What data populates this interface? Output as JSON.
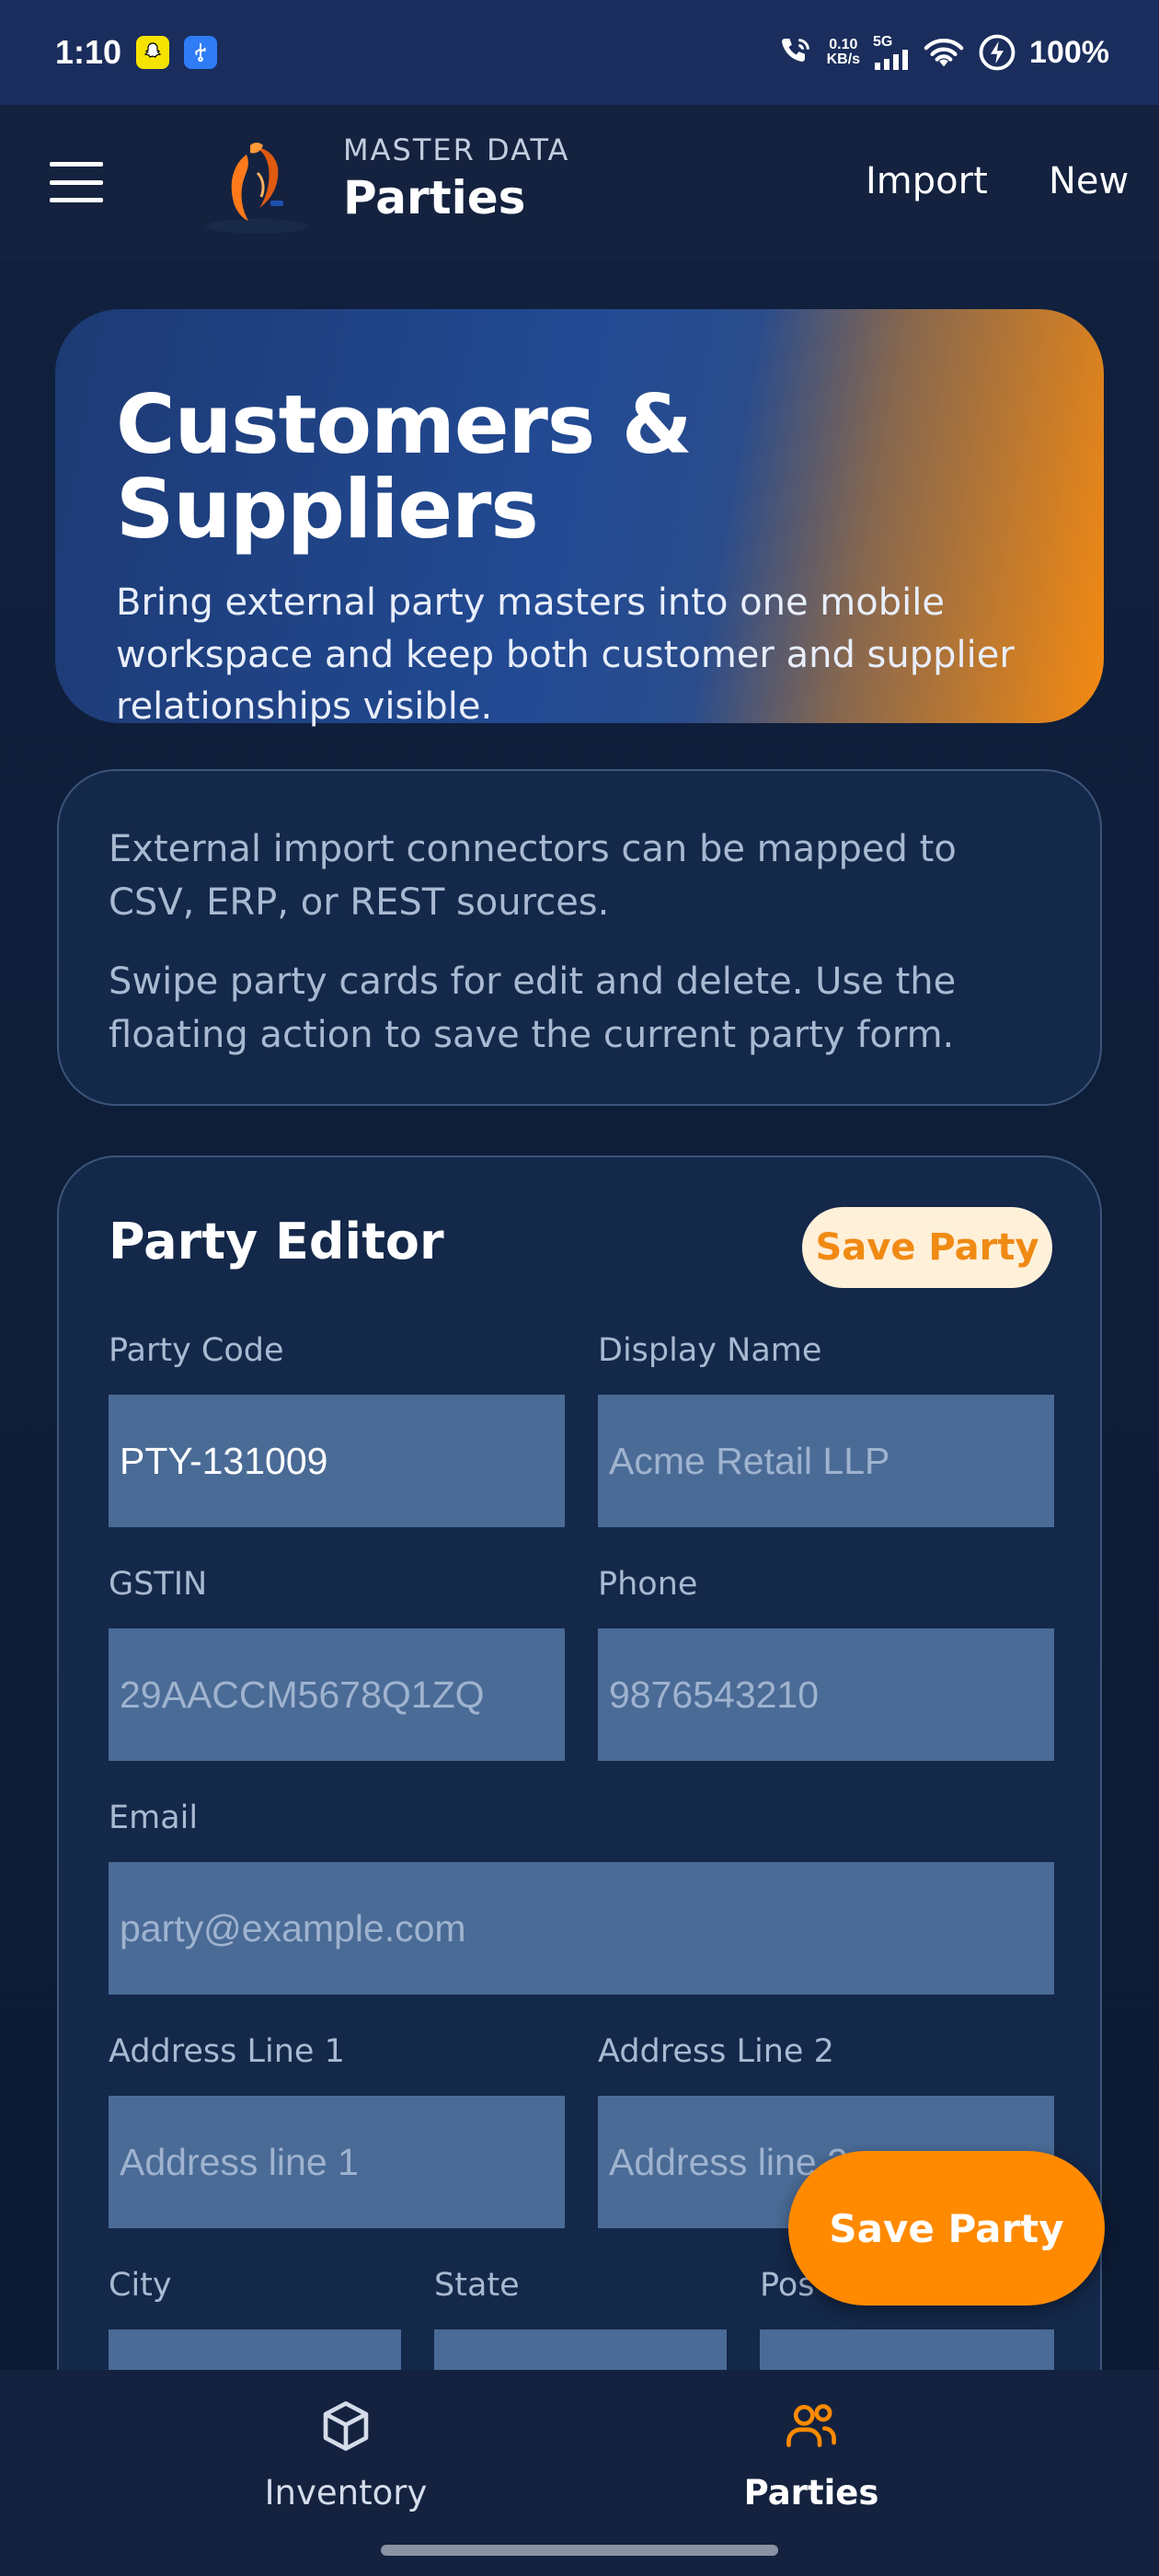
{
  "status_bar": {
    "time": "1:10",
    "net_speed_value": "0.10",
    "net_speed_unit": "KB/s",
    "network": "5G",
    "battery": "100%"
  },
  "app_bar": {
    "eyebrow": "MASTER DATA",
    "title": "Parties",
    "import_label": "Import",
    "new_label": "New"
  },
  "hero": {
    "title": "Customers & Suppliers",
    "text": "Bring external party masters into one mobile workspace and keep both customer and supplier relationships visible."
  },
  "info": {
    "line1": "External import connectors can be mapped to CSV, ERP, or REST sources.",
    "line2": "Swipe party cards for edit and delete. Use the floating action to save the current party form."
  },
  "editor": {
    "title": "Party Editor",
    "save_label": "Save Party",
    "fields": {
      "party_code": {
        "label": "Party Code",
        "value": "PTY-131009"
      },
      "display_name": {
        "label": "Display Name",
        "placeholder": "Acme Retail LLP"
      },
      "gstin": {
        "label": "GSTIN",
        "placeholder": "29AACCM5678Q1ZQ"
      },
      "phone": {
        "label": "Phone",
        "placeholder": "9876543210"
      },
      "email": {
        "label": "Email",
        "placeholder": "party@example.com"
      },
      "address1": {
        "label": "Address Line 1",
        "placeholder": "Address line 1"
      },
      "address2": {
        "label": "Address Line 2",
        "placeholder": "Address line 2"
      },
      "city": {
        "label": "City"
      },
      "state": {
        "label": "State"
      },
      "postal": {
        "label": "Pos"
      }
    }
  },
  "fab": {
    "label": "Save Party"
  },
  "bottom_nav": {
    "items": [
      {
        "label": "Inventory",
        "icon": "box-icon",
        "active": false
      },
      {
        "label": "Parties",
        "icon": "users-icon",
        "active": true
      }
    ]
  },
  "colors": {
    "accent": "#ff8a00",
    "background": "#0c1a33",
    "card": "#14284a",
    "input": "#4a6b96"
  }
}
